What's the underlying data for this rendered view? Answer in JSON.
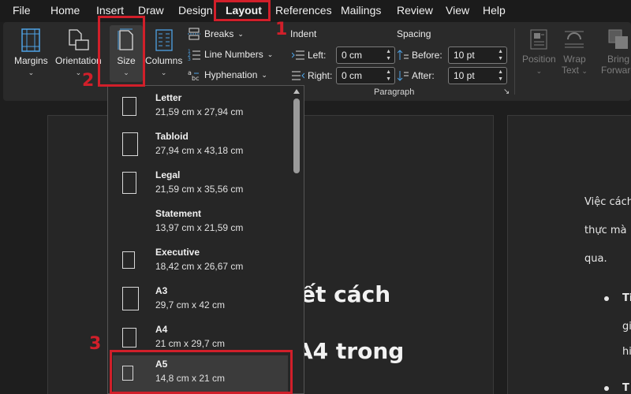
{
  "menubar": {
    "items": [
      "File",
      "Home",
      "Insert",
      "Draw",
      "Design",
      "Layout",
      "References",
      "Mailings",
      "Review",
      "View",
      "Help"
    ],
    "active": "Layout"
  },
  "annotations": {
    "step1": "1",
    "step2": "2",
    "step3": "3"
  },
  "ribbon": {
    "margins": "Margins",
    "orientation": "Orientation",
    "size": "Size",
    "columns": "Columns",
    "breaks": "Breaks",
    "line_numbers": "Line Numbers",
    "hyphenation": "Hyphenation",
    "indent": {
      "title": "Indent",
      "left_label": "Left:",
      "left_value": "0 cm",
      "right_label": "Right:",
      "right_value": "0 cm"
    },
    "spacing": {
      "title": "Spacing",
      "before_label": "Before:",
      "before_value": "10 pt",
      "after_label": "After:",
      "after_value": "10 pt"
    },
    "paragraph_group": "Paragraph",
    "position": "Position",
    "wrap_text_1": "Wrap",
    "wrap_text_2": "Text",
    "bring_forward_1": "Bring",
    "bring_forward_2": "Forward"
  },
  "size_menu": {
    "items": [
      {
        "name": "Letter",
        "dims": "21,59 cm x 27,94 cm"
      },
      {
        "name": "Tabloid",
        "dims": "27,94 cm x 43,18 cm"
      },
      {
        "name": "Legal",
        "dims": "21,59 cm x 35,56 cm"
      },
      {
        "name": "Statement",
        "dims": "13,97 cm x 21,59 cm"
      },
      {
        "name": "Executive",
        "dims": "18,42 cm x 26,67 cm"
      },
      {
        "name": "A3",
        "dims": "29,7 cm x 42 cm"
      },
      {
        "name": "A4",
        "dims": "21 cm x 29,7 cm"
      },
      {
        "name": "A5",
        "dims": "14,8 cm x 21 cm"
      }
    ],
    "selected": "A5"
  },
  "document": {
    "heading_line1": "ết cách",
    "heading_line2": "A4 trong",
    "para_line1": "Việc cách",
    "para_line2": "thực mà",
    "para_line3": "qua.",
    "bullet1_start": "Ti",
    "bullet1_line2": "gi",
    "bullet1_line3": "hi",
    "bullet2_start": "T"
  }
}
